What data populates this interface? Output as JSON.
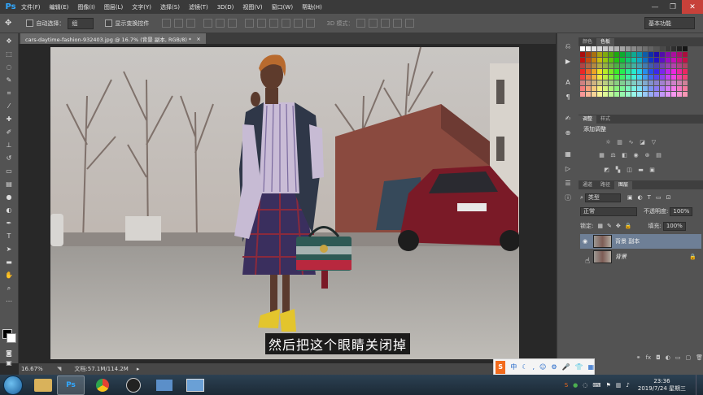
{
  "app": {
    "logo": "Ps"
  },
  "menu": [
    "文件(F)",
    "编辑(E)",
    "图像(I)",
    "图层(L)",
    "文字(Y)",
    "选择(S)",
    "滤镜(T)",
    "3D(D)",
    "视图(V)",
    "窗口(W)",
    "帮助(H)"
  ],
  "window_controls": {
    "minimize": "—",
    "restore": "❐",
    "close": "✕"
  },
  "options": {
    "auto_select_label": "自动选择：",
    "auto_select_value": "组",
    "show_transform_label": "显示变换控件",
    "mode_3d_label": "3D 模式：",
    "workspace": "基本功能"
  },
  "document": {
    "tab_title": "cars-daytime-fashion-932403.jpg @ 16.7% (背景 副本, RGB/8) *",
    "tab_close": "×",
    "subtitle": "然后把这个眼睛关闭掉"
  },
  "status": {
    "zoom": "16.67%",
    "doc_info": "文档:57.1M/114.2M"
  },
  "panels": {
    "top_tabs": [
      "颜色",
      "色板"
    ],
    "top_active": 1,
    "mid_tabs": [
      "调整",
      "样式"
    ],
    "mid_active": 0,
    "adjust_title": "添加调整",
    "layer_tabs": [
      "通道",
      "路径",
      "图层"
    ],
    "layer_active": 2,
    "filter_kind": "类型",
    "blend_mode": "正常",
    "opacity_label": "不透明度:",
    "opacity_value": "100%",
    "lock_label": "锁定:",
    "fill_label": "填充:",
    "fill_value": "100%",
    "layers": [
      {
        "name": "背景 副本",
        "visible": true,
        "selected": true
      },
      {
        "name": "背景",
        "visible": false,
        "selected": false,
        "locked": true
      }
    ]
  },
  "ime": {
    "label": "中"
  },
  "taskbar": {
    "time": "23:36",
    "date": "2019/7/24 星期三"
  },
  "colors": {
    "menubar": "#3a3a3a",
    "panel": "#535353",
    "canvas_bg": "#282828",
    "accent": "#31a8ff"
  }
}
